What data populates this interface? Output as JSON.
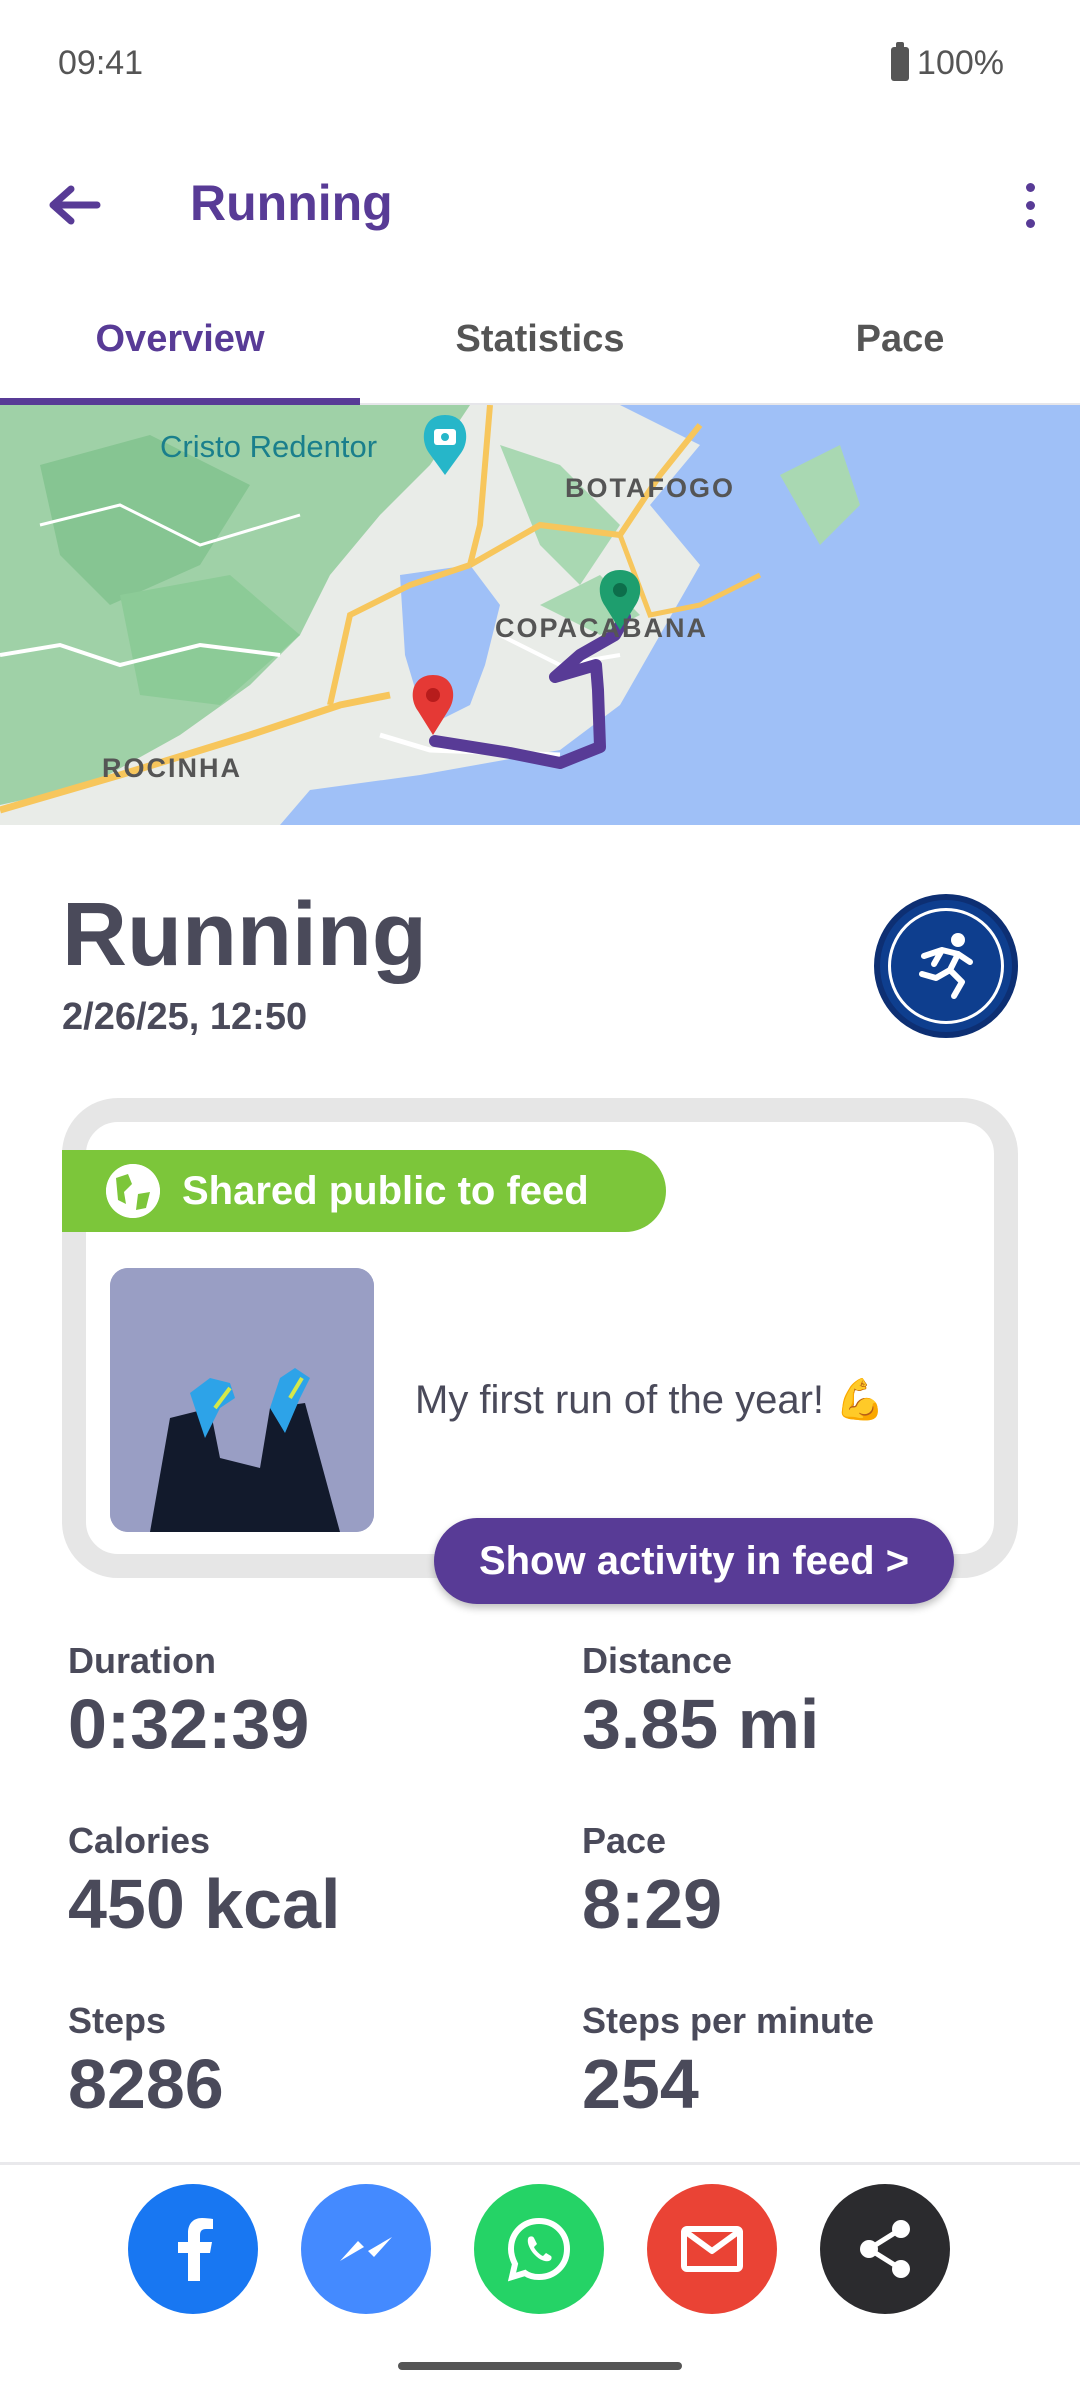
{
  "status": {
    "time": "09:41",
    "battery": "100%"
  },
  "app_bar": {
    "title": "Running"
  },
  "tabs": [
    {
      "label": "Overview",
      "active": true
    },
    {
      "label": "Statistics",
      "active": false
    },
    {
      "label": "Pace",
      "active": false
    }
  ],
  "map": {
    "labels": {
      "cristo": "Cristo Redentor",
      "botafogo": "BOTAFOGO",
      "copacabana": "COPACABANA",
      "rocinha": "ROCINHA"
    }
  },
  "activity": {
    "title": "Running",
    "date": "2/26/25, 12:50"
  },
  "feed": {
    "shared_label": "Shared public to feed",
    "caption": "My first run of the year! 💪",
    "button_label": "Show activity in feed >"
  },
  "stats": [
    {
      "label": "Duration",
      "value": "0:32:39"
    },
    {
      "label": "Distance",
      "value": "3.85 mi"
    },
    {
      "label": "Calories",
      "value": "450 kcal"
    },
    {
      "label": "Pace",
      "value": "8:29"
    },
    {
      "label": "Steps",
      "value": "8286"
    },
    {
      "label": "Steps per minute",
      "value": "254"
    }
  ],
  "share": [
    {
      "icon": "facebook-icon",
      "color": "#1877f2"
    },
    {
      "icon": "messenger-icon",
      "color": "#448aff"
    },
    {
      "icon": "whatsapp-icon",
      "color": "#25d366"
    },
    {
      "icon": "email-icon",
      "color": "#ea4335"
    },
    {
      "icon": "share-icon",
      "color": "#2b2b2e"
    }
  ],
  "colors": {
    "accent": "#583b96",
    "shared_pill": "#7cc63a"
  }
}
